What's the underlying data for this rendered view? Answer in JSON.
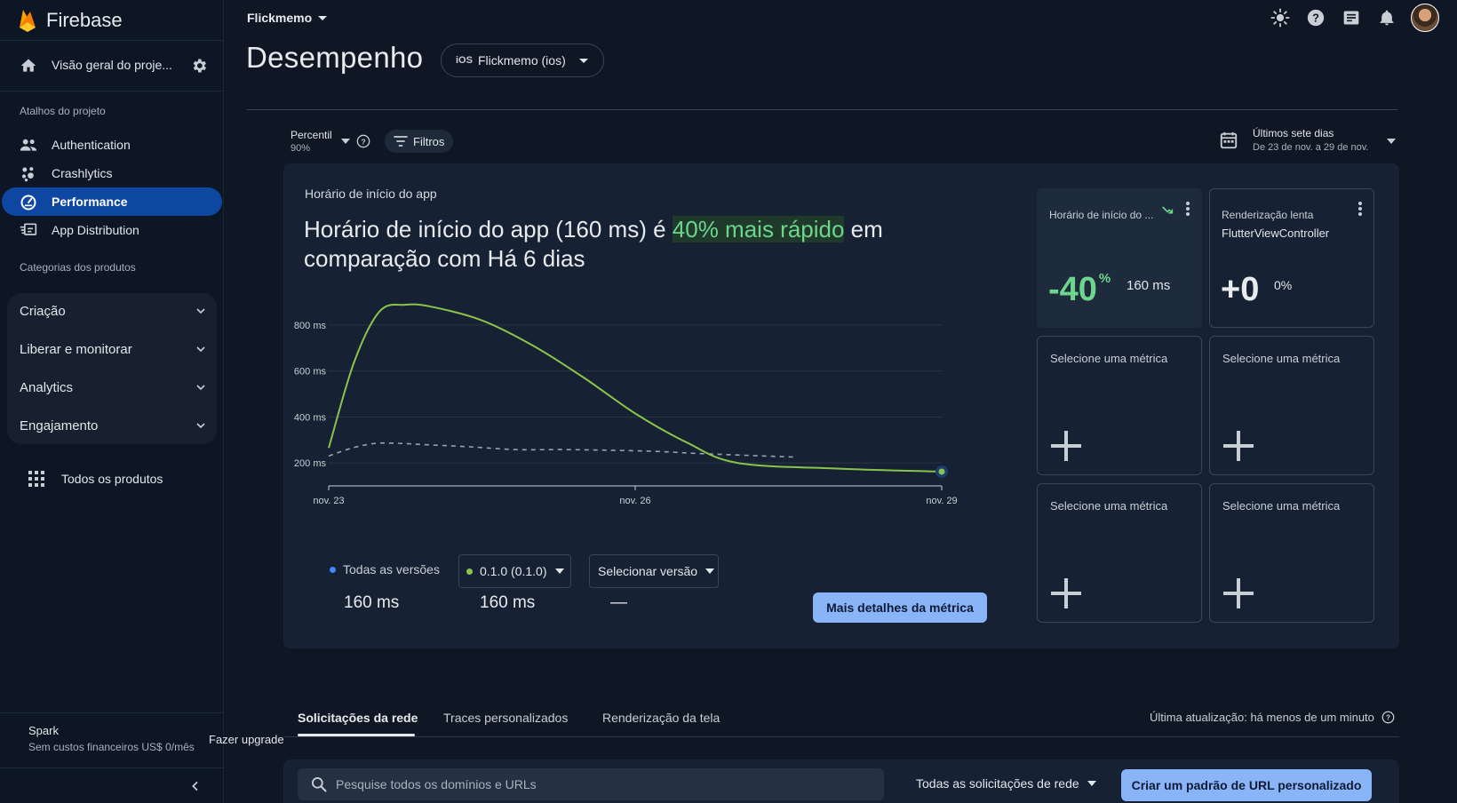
{
  "brand": {
    "name": "Firebase"
  },
  "sidebar": {
    "overview_label": "Visão geral do proje...",
    "shortcuts_label": "Atalhos do projeto",
    "items": [
      {
        "label": "Authentication",
        "icon": "people-icon",
        "active": false
      },
      {
        "label": "Crashlytics",
        "icon": "crashlytics-icon",
        "active": false
      },
      {
        "label": "Performance",
        "icon": "speedometer-icon",
        "active": true
      },
      {
        "label": "App Distribution",
        "icon": "app-distribution-icon",
        "active": false
      }
    ],
    "categories_label": "Categorias dos produtos",
    "categories": [
      {
        "label": "Criação"
      },
      {
        "label": "Liberar e monitorar"
      },
      {
        "label": "Analytics"
      },
      {
        "label": "Engajamento"
      }
    ],
    "all_products": "Todos os produtos",
    "plan_name": "Spark",
    "plan_sub": "Sem custos financeiros US$ 0/mês",
    "upgrade": "Fazer upgrade"
  },
  "header": {
    "project": "Flickmemo",
    "page_title": "Desempenho",
    "app_tag": "iOS",
    "app_name": "Flickmemo (ios)"
  },
  "filters": {
    "percentil_label": "Percentil",
    "percentil_value": "90%",
    "filtros": "Filtros",
    "date_title": "Últimos sete dias",
    "date_range": "De 23 de nov. a 29 de nov."
  },
  "metric_card": {
    "label": "Horário de início do app",
    "headline_pre": "Horário de início do app (160 ms) é ",
    "headline_highlight": "40% mais rápido",
    "headline_post": " em comparação com Há 6 dias",
    "versions": {
      "all": "Todas as versões",
      "v1": "0.1.0 (0.1.0)",
      "select": "Selecionar versão",
      "all_value": "160 ms",
      "v1_value": "160 ms",
      "select_value": "—"
    },
    "details_button": "Mais detalhes da métrica"
  },
  "chart_data": {
    "type": "line",
    "x_labels": [
      "nov. 23",
      "nov. 26",
      "nov. 29"
    ],
    "y_ticks": [
      "200 ms",
      "400 ms",
      "600 ms",
      "800 ms"
    ],
    "ylim": [
      100,
      900
    ],
    "x": [
      0,
      0.25,
      0.5,
      0.75,
      1.0,
      1.5,
      2.0,
      2.5,
      3.0,
      3.5,
      4.0,
      5.0,
      6.0
    ],
    "series": [
      {
        "values": [
          265,
          640,
          860,
          888,
          880,
          820,
          710,
          570,
          415,
          290,
          200,
          175,
          162
        ],
        "color": "#8bc34a",
        "style": "solid"
      },
      {
        "values": [
          230,
          265,
          285,
          285,
          280,
          270,
          258,
          258,
          255,
          250,
          240,
          225
        ],
        "color": "#9aa3ad",
        "style": "dashed"
      }
    ],
    "grid": true
  },
  "tiles": [
    {
      "title": "Horário de início do ...",
      "big": "-40",
      "big_sup": "%",
      "side": "160 ms",
      "trend": "trending-down-icon"
    },
    {
      "title": "Renderização lenta",
      "subtitle": "FlutterViewController",
      "big": "+0",
      "side": "0%"
    },
    {
      "title": "Selecione uma métrica"
    },
    {
      "title": "Selecione uma métrica"
    },
    {
      "title": "Selecione uma métrica"
    },
    {
      "title": "Selecione uma métrica"
    }
  ],
  "tabs": [
    {
      "label": "Solicitações da rede",
      "active": true
    },
    {
      "label": "Traces personalizados",
      "active": false
    },
    {
      "label": "Renderização da tela",
      "active": false
    }
  ],
  "last_update": "Última atualização: há menos de um minuto",
  "search": {
    "placeholder": "Pesquise todos os domínios e URLs"
  },
  "request_filter": "Todas as solicitações de rede",
  "create_button": "Criar um padrão de URL personalizado",
  "colors": {
    "accent": "#8ab4f8",
    "active_nav": "#0d47a1",
    "green": "#6dd58c",
    "line": "#8bc34a"
  }
}
